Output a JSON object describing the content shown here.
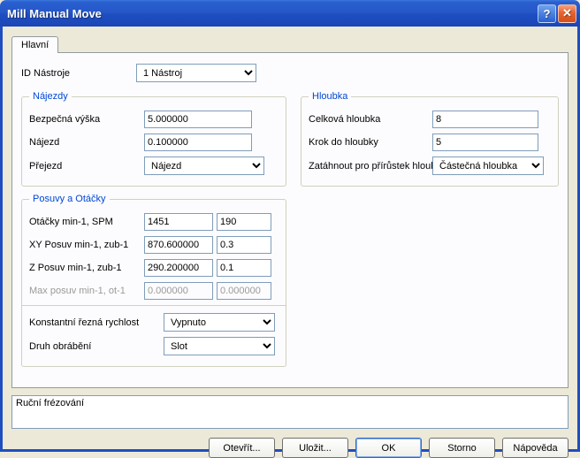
{
  "window": {
    "title": "Mill Manual Move"
  },
  "tabs": {
    "main": "Hlavní"
  },
  "tool": {
    "id_label": "ID Nástroje",
    "id_value": "1 Nástroj"
  },
  "najezdy": {
    "legend": "Nájezdy",
    "safe_height_label": "Bezpečná výška",
    "safe_height_value": "5.000000",
    "approach_label": "Nájezd",
    "approach_value": "0.100000",
    "over_label": "Přejezd",
    "over_value": "Nájezd"
  },
  "hloubka": {
    "legend": "Hloubka",
    "total_label": "Celková hloubka",
    "total_value": "8",
    "step_label": "Krok do hloubky",
    "step_value": "5",
    "retract_label": "Zatáhnout pro přírůstek hloubky",
    "retract_value": "Částečná hloubka"
  },
  "posuvy": {
    "legend": "Posuvy a Otáčky",
    "spm_label": "Otáčky min-1, SPM",
    "spm_val1": "1451",
    "spm_val2": "190",
    "xy_label": "XY Posuv min-1, zub-1",
    "xy_val1": "870.600000",
    "xy_val2": "0.3",
    "z_label": "Z Posuv min-1, zub-1",
    "z_val1": "290.200000",
    "z_val2": "0.1",
    "max_label": "Max posuv min-1, ot-1",
    "max_val1": "0.000000",
    "max_val2": "0.000000",
    "ccs_label": "Konstantní řezná rychlost",
    "ccs_value": "Vypnuto",
    "machining_label": "Druh obrábění",
    "machining_value": "Slot"
  },
  "description": {
    "value": "Ruční frézování"
  },
  "buttons": {
    "open": "Otevřít...",
    "save": "Uložit...",
    "ok": "OK",
    "cancel": "Storno",
    "help": "Nápověda"
  }
}
